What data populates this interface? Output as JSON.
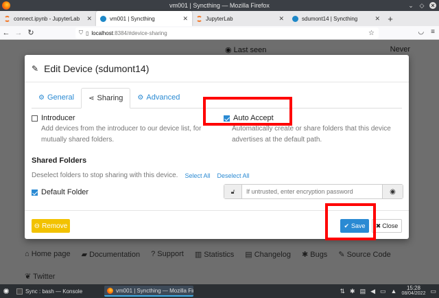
{
  "window": {
    "title": "vm001 | Syncthing — Mozilla Firefox"
  },
  "browser_tabs": [
    {
      "label": "connect.ipynb - JupyterLab",
      "icon": "jupyter-icon"
    },
    {
      "label": "vm001 | Syncthing",
      "icon": "syncthing-icon"
    },
    {
      "label": "JupyterLab",
      "icon": "jupyter-icon"
    },
    {
      "label": "sdumont14 | Syncthing",
      "icon": "syncthing-icon"
    }
  ],
  "url": {
    "host": "localhost",
    "path": ":8384/#device-sharing"
  },
  "background": {
    "last_seen_label": "Last seen",
    "last_seen_value": "Never",
    "footer_links": [
      "Home page",
      "Documentation",
      "Support",
      "Statistics",
      "Changelog",
      "Bugs",
      "Source Code"
    ],
    "twitter": "Twitter"
  },
  "modal": {
    "title": "Edit Device (sdumont14)",
    "tabs": [
      "General",
      "Sharing",
      "Advanced"
    ],
    "introducer": {
      "label": "Introducer",
      "checked": false,
      "help": "Add devices from the introducer to our device list, for mutually shared folders."
    },
    "auto_accept": {
      "label": "Auto Accept",
      "checked": true,
      "help": "Automatically create or share folders that this device advertises at the default path."
    },
    "shared_folders": {
      "title": "Shared Folders",
      "hint": "Deselect folders to stop sharing with this device.",
      "select_all": "Select All",
      "deselect_all": "Deselect All",
      "folder": {
        "label": "Default Folder",
        "checked": true
      },
      "password_placeholder": "If untrusted, enter encryption password"
    },
    "buttons": {
      "remove": "Remove",
      "save": "Save",
      "close": "Close"
    }
  },
  "taskbar": {
    "tasks": [
      "Sync : bash — Konsole",
      "vm001 | Syncthing — Mozilla Fir..."
    ],
    "time": "15:28",
    "date": "08/04/2022"
  },
  "colors": {
    "accent": "#2a8ad3",
    "warning": "#f2c200",
    "annotation": "#ff0000"
  }
}
